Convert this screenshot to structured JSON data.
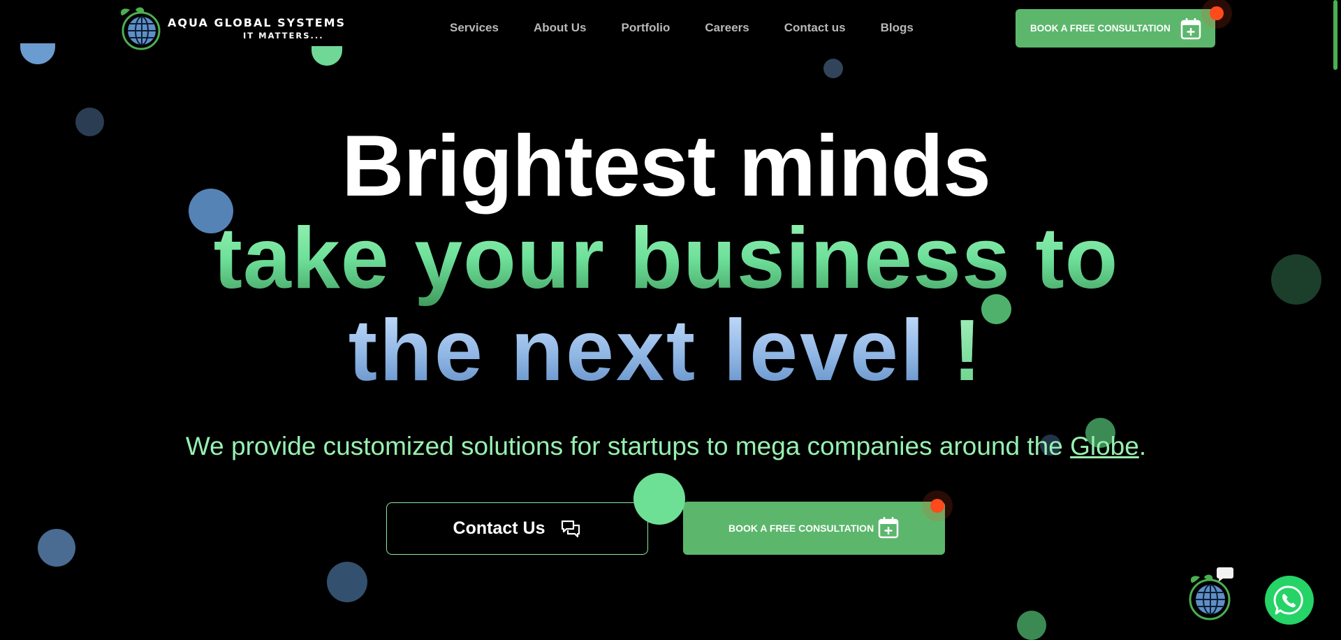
{
  "brand": {
    "name": "AQUA GLOBAL SYSTEMS",
    "tagline": "IT MATTERS...",
    "colors": {
      "accent": "#5cb76c",
      "highlight": "#97f0af",
      "badge": "#ff4a1c",
      "background": "#000000"
    }
  },
  "nav": {
    "items": [
      {
        "label": "Services"
      },
      {
        "label": "About Us"
      },
      {
        "label": "Portfolio"
      },
      {
        "label": "Careers"
      },
      {
        "label": "Contact us"
      },
      {
        "label": "Blogs"
      }
    ]
  },
  "header": {
    "cta_label": "BOOK A FREE CONSULTATION",
    "cta_icon": "calendar-plus-icon"
  },
  "hero": {
    "line1": "Brightest minds",
    "line2": "take your business to",
    "line3": "the next level",
    "line3_mark": "!",
    "subtitle_text": "We provide customized solutions for startups to mega companies around the ",
    "subtitle_link": "Globe",
    "subtitle_end": "."
  },
  "buttons": {
    "contact_label": "Contact Us",
    "contact_icon": "chat-bubbles-icon",
    "consult_label": "BOOK A FREE CONSULTATION",
    "consult_icon": "calendar-plus-icon"
  },
  "widgets": {
    "chatbot_icon": "globe-chatbot-icon",
    "whatsapp_icon": "whatsapp-icon"
  }
}
